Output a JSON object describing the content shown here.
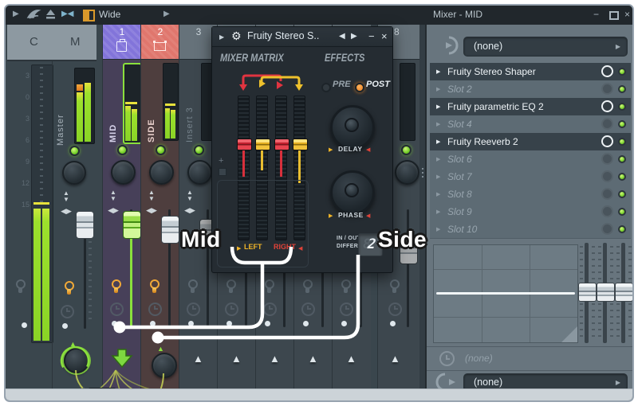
{
  "toolbar": {
    "wide_label": "Wide",
    "play_icon": "▶",
    "detached_icon": "▶",
    "panel_title": "Mixer - MID",
    "minimize": "−",
    "close": "×"
  },
  "left_header": {
    "c": "C",
    "m": "M"
  },
  "db_scale": [
    "3",
    "0",
    "3",
    "6",
    "9",
    "12",
    "15"
  ],
  "master": {
    "label": "Master"
  },
  "channels": [
    {
      "number": "1",
      "label": "MID"
    },
    {
      "number": "2",
      "label": "SIDE"
    },
    {
      "number": "3",
      "label": "Insert 3"
    },
    {
      "number": "8",
      "label": ""
    }
  ],
  "plugin": {
    "title": "Fruity Stereo S..",
    "gear_icon": "⚙",
    "prev_icon": "◀",
    "next_icon": "▶",
    "minimize": "−",
    "close": "×",
    "mixer_matrix_label": "MIXER MATRIX",
    "effects_label": "EFFECTS",
    "pre_label": "PRE",
    "post_label": "POST",
    "delay_label": "DELAY",
    "phase_label": "PHASE",
    "left_label": "LEFT",
    "right_label": "RIGHT",
    "inout_label_line1": "IN / OUT",
    "inout_label_line2": "DIFFERENCE",
    "difference_value": "2"
  },
  "annotations": {
    "mid_label": "Mid",
    "side_label": "Side"
  },
  "mixer_panel": {
    "title": "Mixer - MID",
    "input_value": "(none)",
    "slots": [
      {
        "name": "Fruity Stereo Shaper",
        "filled": true
      },
      {
        "name": "Slot 2",
        "filled": false
      },
      {
        "name": "Fruity parametric EQ 2",
        "filled": true
      },
      {
        "name": "Slot 4",
        "filled": false
      },
      {
        "name": "Fruity Reeverb 2",
        "filled": true
      },
      {
        "name": "Slot 6",
        "filled": false
      },
      {
        "name": "Slot 7",
        "filled": false
      },
      {
        "name": "Slot 8",
        "filled": false
      },
      {
        "name": "Slot 9",
        "filled": false
      },
      {
        "name": "Slot 10",
        "filled": false
      }
    ],
    "time_value": "(none)",
    "output_value": "(none)"
  },
  "colors": {
    "accent_green": "#7ed32f",
    "accent_orange": "#f08828",
    "fader_red": "#e03440",
    "fader_yellow": "#eec12c",
    "channel1_purple": "#8274da",
    "channel2_red": "#e0766d",
    "annotation": "#ffffff"
  }
}
